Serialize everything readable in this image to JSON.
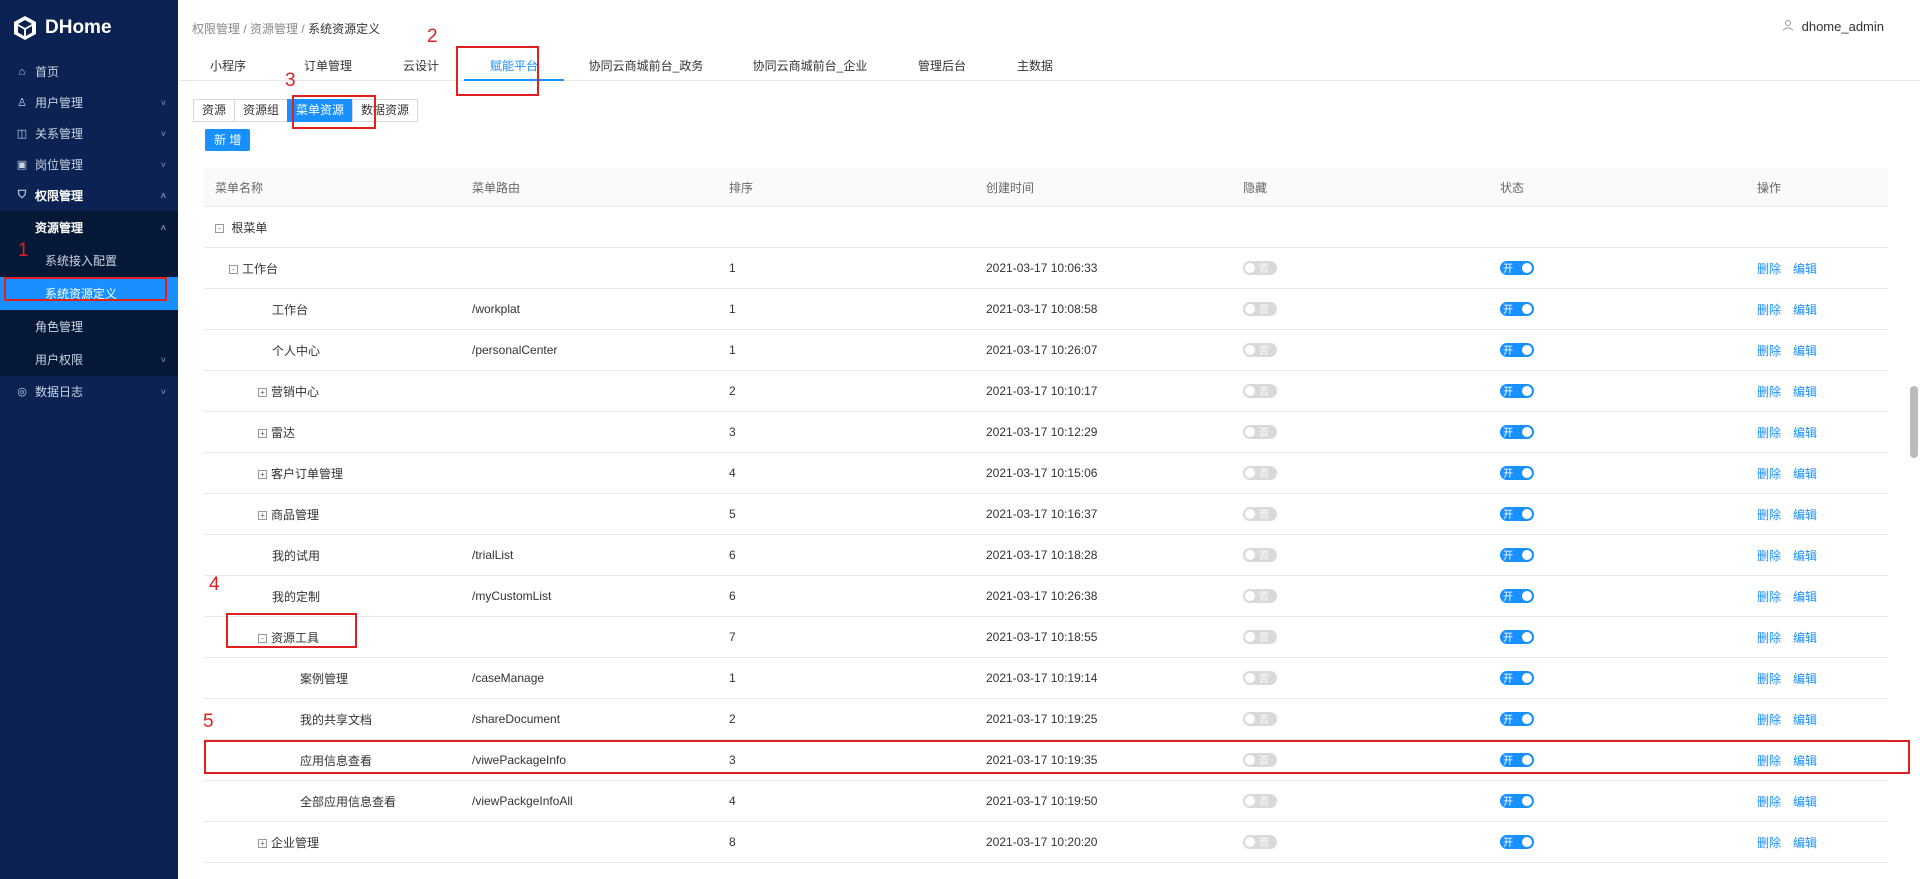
{
  "app": {
    "name": "DHome"
  },
  "user": {
    "name": "dhome_admin"
  },
  "breadcrumb": [
    "权限管理",
    "资源管理",
    "系统资源定义"
  ],
  "sidebar": [
    {
      "label": "首页",
      "icon": "home-icon",
      "arrow": ""
    },
    {
      "label": "用户管理",
      "icon": "user-icon",
      "arrow": "˅"
    },
    {
      "label": "关系管理",
      "icon": "relation-icon",
      "arrow": "˅"
    },
    {
      "label": "岗位管理",
      "icon": "post-icon",
      "arrow": "˅"
    },
    {
      "label": "权限管理",
      "icon": "shield-icon",
      "arrow": "˄"
    },
    {
      "label": "资源管理",
      "arrow": "˄"
    },
    {
      "label": "系统接入配置"
    },
    {
      "label": "系统资源定义"
    },
    {
      "label": "角色管理"
    },
    {
      "label": "用户权限",
      "arrow": "˅"
    },
    {
      "label": "数据日志",
      "icon": "log-icon",
      "arrow": "˅"
    }
  ],
  "tabs": [
    "小程序",
    "订单管理",
    "云设计",
    "赋能平台",
    "协同云商城前台_政务",
    "协同云商城前台_企业",
    "管理后台",
    "主数据"
  ],
  "active_tab": "赋能平台",
  "segments": [
    "资源",
    "资源组",
    "菜单资源",
    "数据资源"
  ],
  "active_segment": "菜单资源",
  "add_button": "新 增",
  "table": {
    "headers": [
      "菜单名称",
      "菜单路由",
      "排序",
      "创建时间",
      "隐藏",
      "状态",
      "操作"
    ],
    "toggle_off_label": "否",
    "toggle_on_label": "开",
    "actions": [
      "删除",
      "编辑"
    ],
    "root": {
      "name": "根菜单",
      "expander": "-"
    },
    "rows": [
      {
        "name": "工作台",
        "route": "",
        "sort": "1",
        "created": "2021-03-17 10:06:33",
        "expander": "-",
        "level": 1
      },
      {
        "name": "工作台",
        "route": "/workplat",
        "sort": "1",
        "created": "2021-03-17 10:08:58",
        "expander": "",
        "level": 2
      },
      {
        "name": "个人中心",
        "route": "/personalCenter",
        "sort": "1",
        "created": "2021-03-17 10:26:07",
        "expander": "",
        "level": 2
      },
      {
        "name": "营销中心",
        "route": "",
        "sort": "2",
        "created": "2021-03-17 10:10:17",
        "expander": "+",
        "level": 2
      },
      {
        "name": "雷达",
        "route": "",
        "sort": "3",
        "created": "2021-03-17 10:12:29",
        "expander": "+",
        "level": 2
      },
      {
        "name": "客户订单管理",
        "route": "",
        "sort": "4",
        "created": "2021-03-17 10:15:06",
        "expander": "+",
        "level": 2
      },
      {
        "name": "商品管理",
        "route": "",
        "sort": "5",
        "created": "2021-03-17 10:16:37",
        "expander": "+",
        "level": 2
      },
      {
        "name": "我的试用",
        "route": "/trialList",
        "sort": "6",
        "created": "2021-03-17 10:18:28",
        "expander": "",
        "level": 2
      },
      {
        "name": "我的定制",
        "route": "/myCustomList",
        "sort": "6",
        "created": "2021-03-17 10:26:38",
        "expander": "",
        "level": 2
      },
      {
        "name": "资源工具",
        "route": "",
        "sort": "7",
        "created": "2021-03-17 10:18:55",
        "expander": "-",
        "level": 2
      },
      {
        "name": "案例管理",
        "route": "/caseManage",
        "sort": "1",
        "created": "2021-03-17 10:19:14",
        "expander": "",
        "level": 3
      },
      {
        "name": "我的共享文档",
        "route": "/shareDocument",
        "sort": "2",
        "created": "2021-03-17 10:19:25",
        "expander": "",
        "level": 3
      },
      {
        "name": "应用信息查看",
        "route": "/viwePackageInfo",
        "sort": "3",
        "created": "2021-03-17 10:19:35",
        "expander": "",
        "level": 3
      },
      {
        "name": "全部应用信息查看",
        "route": "/viewPackgeInfoAll",
        "sort": "4",
        "created": "2021-03-17 10:19:50",
        "expander": "",
        "level": 3
      },
      {
        "name": "企业管理",
        "route": "",
        "sort": "8",
        "created": "2021-03-17 10:20:20",
        "expander": "+",
        "level": 2
      }
    ]
  },
  "annotations": [
    "1",
    "2",
    "3",
    "4",
    "5"
  ],
  "colors": {
    "sidebar_bg": "#0b2253",
    "accent": "#1890ff",
    "annotation": "#e02020"
  }
}
